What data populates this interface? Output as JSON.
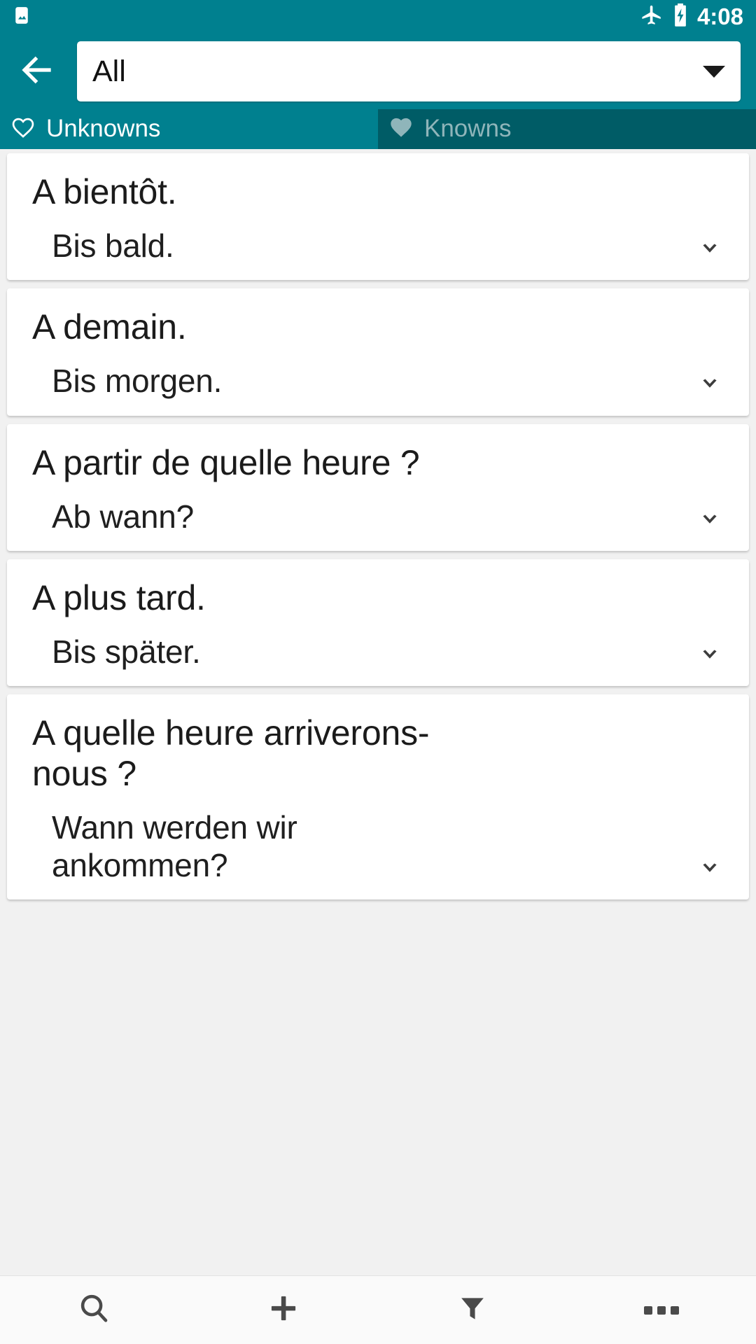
{
  "theme": {
    "primary": "#00808F",
    "primary_dark": "#005C66",
    "tab_inactive_text": "#8FB5BA",
    "card_background": "#FFFFFF",
    "list_background": "#F1F1F1",
    "bottom_bar_background": "#FAFAFA",
    "icon_gray": "#4A4A4A"
  },
  "status_bar": {
    "notification_icon": "image-icon",
    "airplane_icon": "airplane-mode-icon",
    "battery_icon": "battery-charging-icon",
    "clock": "4:08"
  },
  "top_bar": {
    "back_icon": "back-arrow-icon",
    "spinner": {
      "selected_value": "All",
      "caret_icon": "dropdown-caret-icon"
    }
  },
  "tabs": [
    {
      "label": "Unknowns",
      "icon": "heart-outline-icon",
      "active": true
    },
    {
      "label": "Knowns",
      "icon": "heart-filled-icon",
      "active": false
    }
  ],
  "list": {
    "items": [
      {
        "front": "A bientôt.",
        "back": "Bis bald.",
        "expand_icon": "chevron-down-icon"
      },
      {
        "front": "A demain.",
        "back": "Bis morgen.",
        "expand_icon": "chevron-down-icon"
      },
      {
        "front": "A partir de quelle heure ?",
        "back": "Ab wann?",
        "expand_icon": "chevron-down-icon"
      },
      {
        "front": "A plus tard.",
        "back": "Bis später.",
        "expand_icon": "chevron-down-icon"
      },
      {
        "front": "A quelle heure arriverons-nous ?",
        "back": "Wann werden wir ankommen?",
        "expand_icon": "chevron-down-icon"
      }
    ]
  },
  "bottom_bar": {
    "buttons": [
      {
        "name": "search",
        "icon": "search-icon"
      },
      {
        "name": "add",
        "icon": "plus-icon"
      },
      {
        "name": "filter",
        "icon": "filter-funnel-icon"
      },
      {
        "name": "more",
        "icon": "overflow-dots-icon"
      }
    ]
  }
}
